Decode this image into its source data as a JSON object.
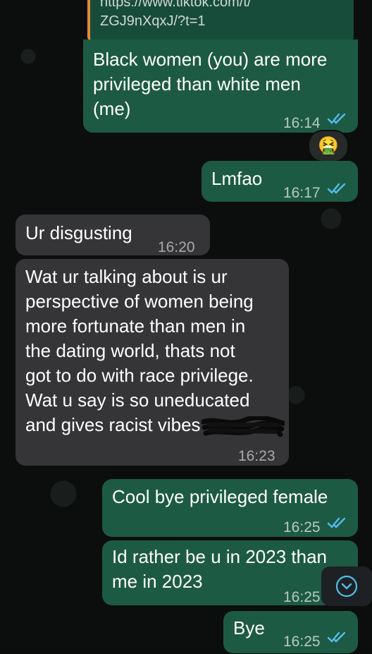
{
  "quote": {
    "line1": "https://www.tiktok.com/t/",
    "line2": "ZGJ9nXqxJ/?t=1"
  },
  "messages": [
    {
      "text": "Black women (you) are more\nprivileged than white men\n(me)",
      "time": "16:14",
      "direction": "outgoing",
      "status": "read"
    },
    {
      "text": "Lmfao",
      "time": "16:17",
      "direction": "outgoing",
      "status": "read"
    },
    {
      "text": "Ur disgusting",
      "time": "16:20",
      "direction": "incoming"
    },
    {
      "text": "Wat ur talking about is ur\nperspective of women being\nmore fortunate than men in\nthe dating world, thats not\ngot to do with race privilege.\nWat u say is so uneducated\nand gives racist vibes",
      "time": "16:23",
      "direction": "incoming"
    },
    {
      "text": "Cool bye privileged female",
      "time": "16:25",
      "direction": "outgoing",
      "status": "read"
    },
    {
      "text": "Id rather be u in 2023 than\nme in 2023",
      "time": "16:25",
      "direction": "outgoing",
      "status": "read"
    },
    {
      "text": "Bye",
      "time": "16:25",
      "direction": "outgoing",
      "status": "read"
    }
  ],
  "reaction": {
    "emoji": "nauseated-face",
    "glyph": "🤮"
  },
  "icons": {
    "read_receipt": "double-check-icon",
    "scroll_down": "chevron-down-icon"
  },
  "colors": {
    "outgoing_bubble": "#1d5a44",
    "incoming_bubble": "#353537",
    "read_tick": "#53bdeb",
    "quote_bar": "#e0893a",
    "background": "#0c0e0d"
  }
}
